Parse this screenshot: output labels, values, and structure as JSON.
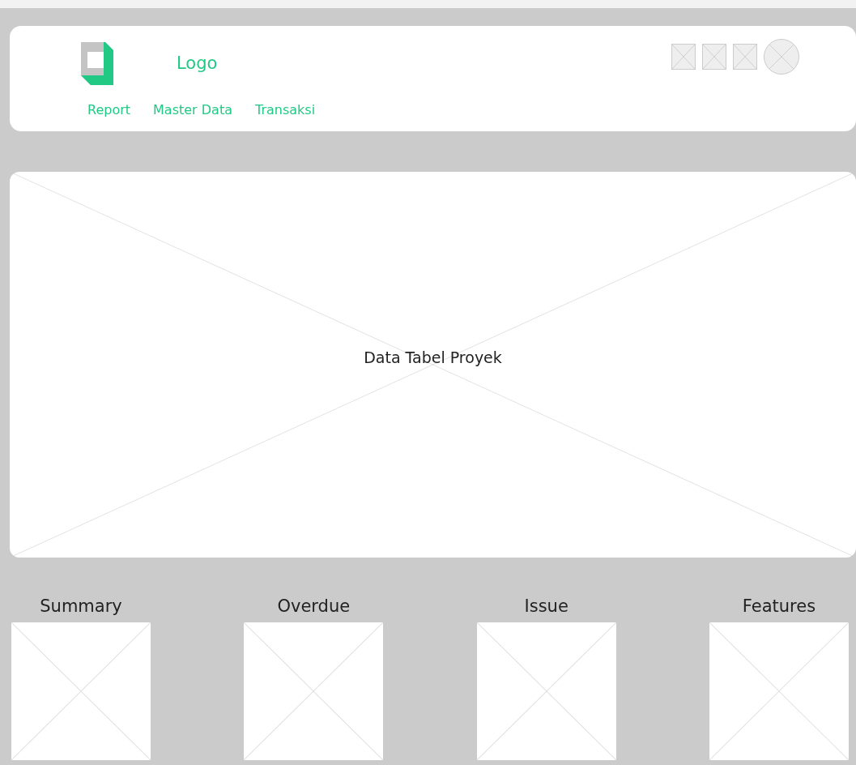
{
  "header": {
    "logo_text": "Logo",
    "nav": [
      {
        "label": "Report"
      },
      {
        "label": "Master Data"
      },
      {
        "label": "Transaksi"
      }
    ],
    "actions": [
      {
        "kind": "square"
      },
      {
        "kind": "square"
      },
      {
        "kind": "square"
      },
      {
        "kind": "circle"
      }
    ]
  },
  "main_panel": {
    "label": "Data Tabel Proyek"
  },
  "cards": [
    {
      "label": "Summary"
    },
    {
      "label": "Overdue"
    },
    {
      "label": "Issue"
    },
    {
      "label": "Features"
    }
  ]
}
